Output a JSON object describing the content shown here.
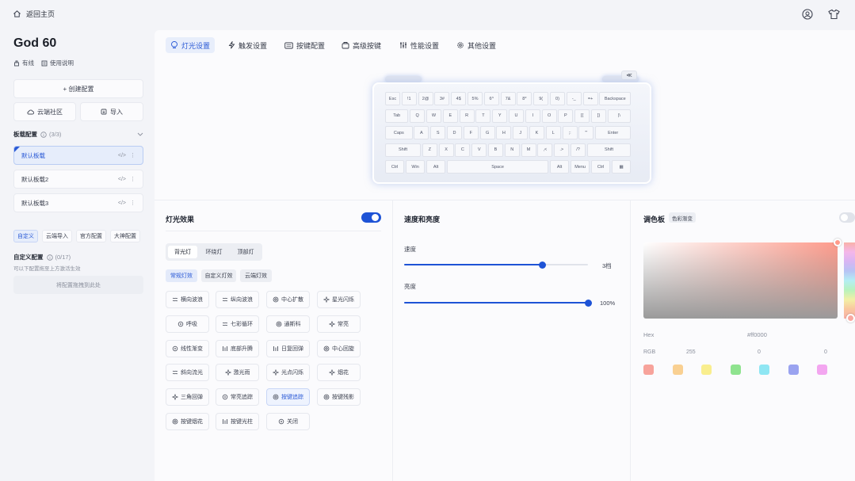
{
  "topbar": {
    "back_label": "返回主页"
  },
  "device": {
    "name": "God 60",
    "status": "有线",
    "manual": "使用说明"
  },
  "sidebar": {
    "create_label": "+ 创建配置",
    "cloud_label": "云端社区",
    "import_label": "导入",
    "profile_header": "板载配置",
    "profile_count": "(3/3)",
    "profiles": [
      {
        "name": "默认板载"
      },
      {
        "name": "默认板载2"
      },
      {
        "name": "默认板载3"
      }
    ],
    "cat_tabs": [
      {
        "label": "自定义"
      },
      {
        "label": "云端导入"
      },
      {
        "label": "官方配置"
      },
      {
        "label": "大神配置"
      }
    ],
    "custom_header": "自定义配置",
    "custom_count": "(0/17)",
    "custom_hint": "可以下配置拖至上方激活生效",
    "drop_label": "将配置拖拽到此处"
  },
  "tabs": [
    {
      "label": "灯光设置"
    },
    {
      "label": "触发设置"
    },
    {
      "label": "按键配置"
    },
    {
      "label": "高级按键"
    },
    {
      "label": "性能设置"
    },
    {
      "label": "其他设置"
    }
  ],
  "keyboard": {
    "top_icon": "≪",
    "rows": [
      [
        "Esc",
        "!1",
        "2@",
        "3#",
        "4$",
        "5%",
        "6^",
        "7&",
        "8*",
        "9(",
        "0)",
        "-_",
        "=+",
        "Backspace"
      ],
      [
        "Tab",
        "Q",
        "W",
        "E",
        "R",
        "T",
        "Y",
        "U",
        "I",
        "O",
        "P",
        "[{",
        "]}",
        "|\\"
      ],
      [
        "Caps",
        "A",
        "S",
        "D",
        "F",
        "G",
        "H",
        "J",
        "K",
        "L",
        ";:",
        "'\"",
        "Enter"
      ],
      [
        "Shift",
        "Z",
        "X",
        "C",
        "V",
        "B",
        "N",
        "M",
        ",<",
        ".>",
        "/?",
        "Shift"
      ],
      [
        "Ctrl",
        "Win",
        "Alt",
        "Space",
        "Alt",
        "Menu",
        "Ctrl",
        "▦"
      ]
    ]
  },
  "lighting": {
    "title": "灯光效果",
    "toggle_on": true,
    "sub_tabs": [
      {
        "label": "背光灯"
      },
      {
        "label": "环绕灯"
      },
      {
        "label": "顶部灯"
      }
    ],
    "mode_tabs": [
      {
        "label": "常规灯效"
      },
      {
        "label": "自定义灯效"
      },
      {
        "label": "云端灯效"
      }
    ],
    "effects": [
      {
        "label": "横向波浪"
      },
      {
        "label": "纵向波浪"
      },
      {
        "label": "中心扩散"
      },
      {
        "label": "星光闪烁"
      },
      {
        "label": "呼吸"
      },
      {
        "label": "七彩循环"
      },
      {
        "label": "通斯科"
      },
      {
        "label": "常亮"
      },
      {
        "label": "线性渐变"
      },
      {
        "label": "底部升腾"
      },
      {
        "label": "日复回弹"
      },
      {
        "label": "中心回旋"
      },
      {
        "label": "斜向流光"
      },
      {
        "label": "激光雨"
      },
      {
        "label": "光点闪烁"
      },
      {
        "label": "烟花"
      },
      {
        "label": "三角回弹"
      },
      {
        "label": "常亮追踪"
      },
      {
        "label": "按键追踪"
      },
      {
        "label": "按键残影"
      },
      {
        "label": "按键烟花"
      },
      {
        "label": "按键光柱"
      },
      {
        "label": "关闭"
      }
    ],
    "selected_effect": "按键追踪"
  },
  "speed": {
    "title": "速度和亮度",
    "speed_label": "速度",
    "speed_value": "3档",
    "speed_fraction": 0.75,
    "brightness_label": "亮度",
    "brightness_value": "100%",
    "brightness_fraction": 1.0
  },
  "palette": {
    "title": "调色板",
    "mode_badge": "色彩渐变",
    "toggle_on": false,
    "hex_label": "Hex",
    "hex_value": "#ff0000",
    "rgb_label": "RGB",
    "r": "255",
    "g": "0",
    "b": "0",
    "swatches": [
      "#f7a39b",
      "#f9d092",
      "#f9ee8e",
      "#8fe38f",
      "#8fe6f3",
      "#9aa3f0",
      "#f3a6f0"
    ]
  }
}
